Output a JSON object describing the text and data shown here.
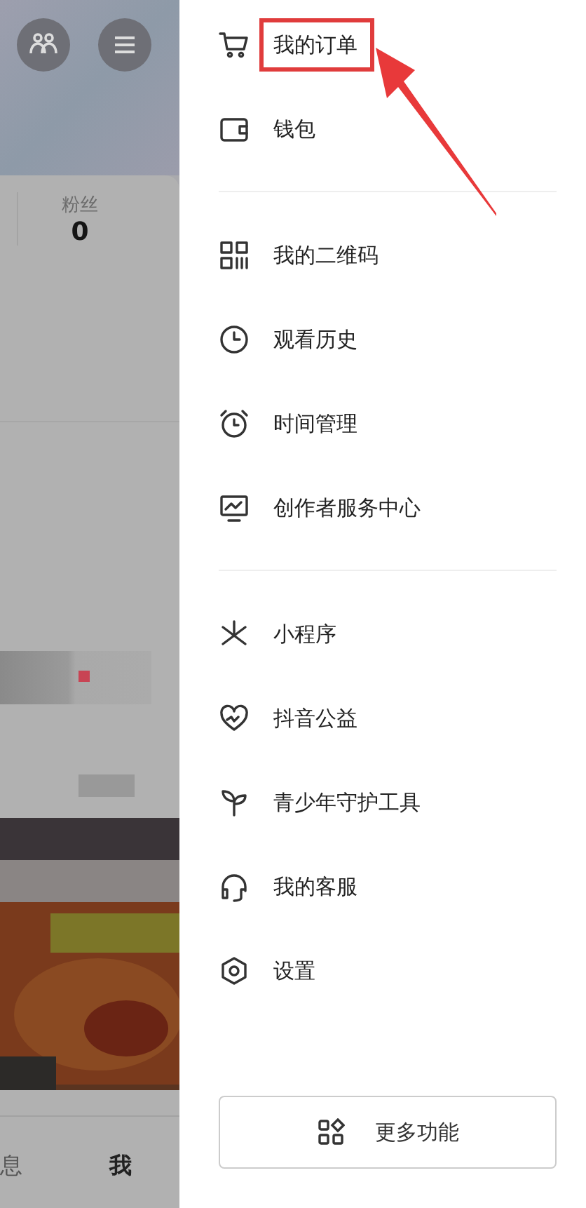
{
  "background_page": {
    "header_buttons": [
      {
        "kind": "friends"
      },
      {
        "kind": "menu"
      }
    ],
    "stats": [
      {
        "label": "粉丝",
        "value": "0"
      }
    ],
    "bottom_tabs": [
      {
        "label": "息",
        "selected": false
      },
      {
        "label": "我",
        "selected": true
      }
    ]
  },
  "drawer": {
    "sections": [
      [
        {
          "kind": "cart",
          "label": "我的订单",
          "highlighted": true
        },
        {
          "kind": "wallet",
          "label": "钱包",
          "highlighted": false
        }
      ],
      [
        {
          "kind": "qr",
          "label": "我的二维码",
          "highlighted": false
        },
        {
          "kind": "clock",
          "label": "观看历史",
          "highlighted": false
        },
        {
          "kind": "alarm",
          "label": "时间管理",
          "highlighted": false
        },
        {
          "kind": "monitor",
          "label": "创作者服务中心",
          "highlighted": false
        }
      ],
      [
        {
          "kind": "miniapp",
          "label": "小程序",
          "highlighted": false
        },
        {
          "kind": "heart",
          "label": "抖音公益",
          "highlighted": false
        },
        {
          "kind": "sprout",
          "label": "青少年守护工具",
          "highlighted": false
        },
        {
          "kind": "headset",
          "label": "我的客服",
          "highlighted": false
        },
        {
          "kind": "settings",
          "label": "设置",
          "highlighted": false
        }
      ]
    ],
    "more_button": {
      "label": "更多功能"
    }
  }
}
